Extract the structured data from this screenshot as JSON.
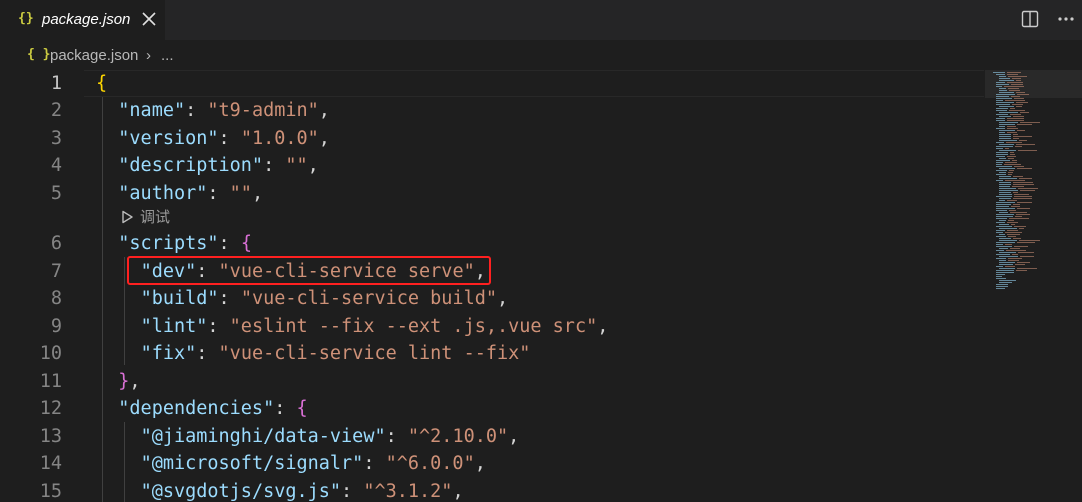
{
  "tab": {
    "icon_glyph": "{}",
    "title": "package.json",
    "close_icon": "close-icon"
  },
  "breadcrumb": {
    "icon_glyph": "{ }",
    "file": "package.json",
    "separator": "›",
    "more": "..."
  },
  "codelens": {
    "icon": "play-icon",
    "label": "调试"
  },
  "editor": {
    "active_line": 1,
    "highlighted_line": 7,
    "lines": [
      {
        "num": "1",
        "tokens": [
          {
            "t": "{",
            "c": "b1"
          }
        ]
      },
      {
        "num": "2",
        "tokens": [
          {
            "t": "  ",
            "c": "p"
          },
          {
            "t": "\"name\"",
            "c": "k"
          },
          {
            "t": ": ",
            "c": "p"
          },
          {
            "t": "\"t9-admin\"",
            "c": "s"
          },
          {
            "t": ",",
            "c": "p"
          }
        ]
      },
      {
        "num": "3",
        "tokens": [
          {
            "t": "  ",
            "c": "p"
          },
          {
            "t": "\"version\"",
            "c": "k"
          },
          {
            "t": ": ",
            "c": "p"
          },
          {
            "t": "\"1.0.0\"",
            "c": "s"
          },
          {
            "t": ",",
            "c": "p"
          }
        ]
      },
      {
        "num": "4",
        "tokens": [
          {
            "t": "  ",
            "c": "p"
          },
          {
            "t": "\"description\"",
            "c": "k"
          },
          {
            "t": ": ",
            "c": "p"
          },
          {
            "t": "\"\"",
            "c": "s"
          },
          {
            "t": ",",
            "c": "p"
          }
        ]
      },
      {
        "num": "5",
        "tokens": [
          {
            "t": "  ",
            "c": "p"
          },
          {
            "t": "\"author\"",
            "c": "k"
          },
          {
            "t": ": ",
            "c": "p"
          },
          {
            "t": "\"\"",
            "c": "s"
          },
          {
            "t": ",",
            "c": "p"
          }
        ]
      },
      {
        "num": "6",
        "tokens": [
          {
            "t": "  ",
            "c": "p"
          },
          {
            "t": "\"scripts\"",
            "c": "k"
          },
          {
            "t": ": ",
            "c": "p"
          },
          {
            "t": "{",
            "c": "b2"
          }
        ]
      },
      {
        "num": "7",
        "tokens": [
          {
            "t": "    ",
            "c": "p"
          },
          {
            "t": "\"dev\"",
            "c": "k"
          },
          {
            "t": ": ",
            "c": "p"
          },
          {
            "t": "\"vue-cli-service serve\"",
            "c": "s"
          },
          {
            "t": ",",
            "c": "p"
          }
        ]
      },
      {
        "num": "8",
        "tokens": [
          {
            "t": "    ",
            "c": "p"
          },
          {
            "t": "\"build\"",
            "c": "k"
          },
          {
            "t": ": ",
            "c": "p"
          },
          {
            "t": "\"vue-cli-service build\"",
            "c": "s"
          },
          {
            "t": ",",
            "c": "p"
          }
        ]
      },
      {
        "num": "9",
        "tokens": [
          {
            "t": "    ",
            "c": "p"
          },
          {
            "t": "\"lint\"",
            "c": "k"
          },
          {
            "t": ": ",
            "c": "p"
          },
          {
            "t": "\"eslint --fix --ext .js,.vue src\"",
            "c": "s"
          },
          {
            "t": ",",
            "c": "p"
          }
        ]
      },
      {
        "num": "10",
        "tokens": [
          {
            "t": "    ",
            "c": "p"
          },
          {
            "t": "\"fix\"",
            "c": "k"
          },
          {
            "t": ": ",
            "c": "p"
          },
          {
            "t": "\"vue-cli-service lint --fix\"",
            "c": "s"
          }
        ]
      },
      {
        "num": "11",
        "tokens": [
          {
            "t": "  ",
            "c": "p"
          },
          {
            "t": "}",
            "c": "b2"
          },
          {
            "t": ",",
            "c": "p"
          }
        ]
      },
      {
        "num": "12",
        "tokens": [
          {
            "t": "  ",
            "c": "p"
          },
          {
            "t": "\"dependencies\"",
            "c": "k"
          },
          {
            "t": ": ",
            "c": "p"
          },
          {
            "t": "{",
            "c": "b2"
          }
        ]
      },
      {
        "num": "13",
        "tokens": [
          {
            "t": "    ",
            "c": "p"
          },
          {
            "t": "\"@jiaminghi/data-view\"",
            "c": "k"
          },
          {
            "t": ": ",
            "c": "p"
          },
          {
            "t": "\"^2.10.0\"",
            "c": "s"
          },
          {
            "t": ",",
            "c": "p"
          }
        ]
      },
      {
        "num": "14",
        "tokens": [
          {
            "t": "    ",
            "c": "p"
          },
          {
            "t": "\"@microsoft/signalr\"",
            "c": "k"
          },
          {
            "t": ": ",
            "c": "p"
          },
          {
            "t": "\"^6.0.0\"",
            "c": "s"
          },
          {
            "t": ",",
            "c": "p"
          }
        ]
      },
      {
        "num": "15",
        "tokens": [
          {
            "t": "    ",
            "c": "p"
          },
          {
            "t": "\"@svgdotjs/svg.js\"",
            "c": "k"
          },
          {
            "t": ": ",
            "c": "p"
          },
          {
            "t": "\"^3.1.2\"",
            "c": "s"
          },
          {
            "t": ",",
            "c": "p"
          }
        ]
      }
    ]
  },
  "colors": {
    "background": "#1e1e1e",
    "tabbar": "#252526",
    "key": "#9cdcfe",
    "string": "#ce9178",
    "punctuation": "#d4d4d4",
    "bracket_level1": "#ffd700",
    "bracket_level2": "#da70d6",
    "json_icon": "#cbcb41",
    "highlight_box": "#ff2020"
  }
}
